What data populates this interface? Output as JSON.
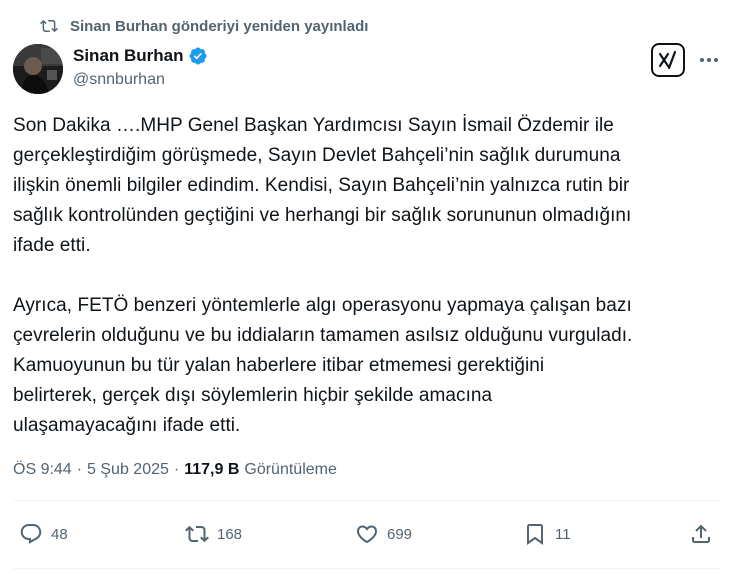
{
  "repost": {
    "icon": "repost-icon",
    "text": "Sinan Burhan gönderiyi yeniden yayınladı"
  },
  "author": {
    "display_name": "Sinan Burhan",
    "handle": "@snnburhan",
    "verified": true,
    "verified_color": "#1d9bf0"
  },
  "tweet": {
    "text": "Son Dakika ….MHP Genel Başkan Yardımcısı Sayın İsmail Özdemir ile\ngerçekleştirdiğim görüşmede, Sayın Devlet Bahçeli’nin sağlık durumuna\nilişkin önemli bilgiler edindim. Kendisi, Sayın Bahçeli’nin yalnızca rutin bir\nsağlık kontrolünden geçtiğini ve herhangi bir sağlık sorununun olmadığını\nifade etti.\n\nAyrıca, FETÖ benzeri yöntemlerle algı operasyonu yapmaya çalışan bazı\nçevrelerin olduğunu ve bu iddiaların tamamen asılsız olduğunu vurguladı.\nKamuoyunun bu tür yalan haberlere itibar etmemesi gerektiğini\nbelirterek, gerçek dışı söylemlerin hiçbir şekilde amacına\nulaşamayacağını ifade etti."
  },
  "meta": {
    "time": "ÖS 9:44",
    "separator1": "·",
    "date": "5 Şub 2025",
    "separator2": "·",
    "views_count": "117,9 B",
    "views_label": "Görüntüleme"
  },
  "actions": {
    "replies": "48",
    "reposts": "168",
    "likes": "699",
    "bookmarks": "11"
  },
  "colors": {
    "text": "#0f1419",
    "secondary": "#536471",
    "divider": "#eff3f4",
    "accent": "#1d9bf0"
  }
}
